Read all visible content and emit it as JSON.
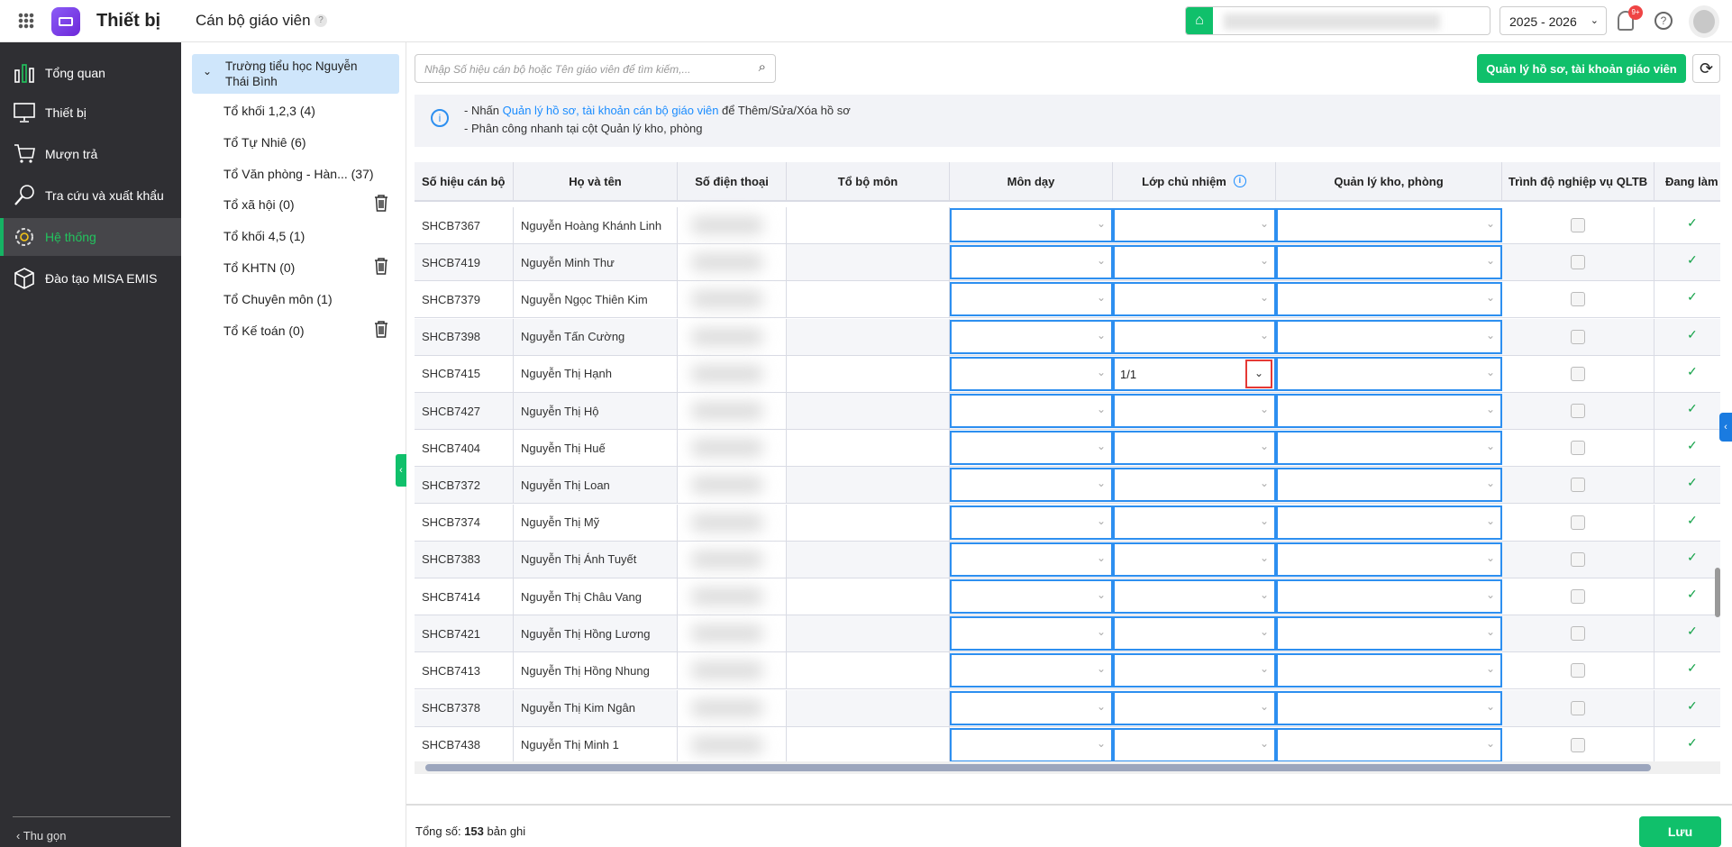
{
  "header": {
    "app_name": "Thiết bị",
    "page_title": "Cán bộ giáo viên",
    "help_badge": "?",
    "school_year": "2025 - 2026",
    "notification_count": "9+"
  },
  "sidebar": {
    "items": [
      {
        "label": "Tổng quan",
        "icon": "bar-chart-icon"
      },
      {
        "label": "Thiết bị",
        "icon": "monitor-icon"
      },
      {
        "label": "Mượn trả",
        "icon": "cart-icon"
      },
      {
        "label": "Tra cứu và xuất khẩu",
        "icon": "search-icon"
      },
      {
        "label": "Hệ thống",
        "icon": "gear-icon",
        "active": true
      },
      {
        "label": "Đào tạo MISA EMIS",
        "icon": "cube-icon"
      }
    ],
    "collapse_label": "Thu gọn"
  },
  "tree": {
    "root": "Trường tiểu học Nguyễn Thái Bình",
    "items": [
      {
        "label": "Tổ khối 1,2,3 (4)"
      },
      {
        "label": "Tổ Tự Nhiê (6)"
      },
      {
        "label": "Tổ Văn phòng - Hàn... (37)"
      },
      {
        "label": "Tổ xã hội (0)",
        "deletable": true
      },
      {
        "label": "Tổ khối 4,5 (1)"
      },
      {
        "label": "Tổ KHTN (0)",
        "deletable": true
      },
      {
        "label": "Tổ Chuyên môn (1)"
      },
      {
        "label": "Tổ Kế toán (0)",
        "deletable": true
      }
    ]
  },
  "toolbar": {
    "search_placeholder": "Nhập Số hiệu cán bộ hoặc Tên giáo viên để tìm kiếm,...",
    "manage_button": "Quản lý hồ sơ, tài khoản giáo viên"
  },
  "info": {
    "line1_prefix": "- Nhấn ",
    "line1_link": "Quản lý hồ sơ, tài khoản cán bộ giáo viên",
    "line1_suffix": " để Thêm/Sửa/Xóa hồ sơ",
    "line2": "- Phân công nhanh tại cột Quản lý kho, phòng"
  },
  "table": {
    "columns": [
      "Số hiệu cán bộ",
      "Họ và tên",
      "Số điện thoại",
      "Tổ bộ môn",
      "Môn dạy",
      "Lớp chủ nhiệm",
      "Quản lý kho, phòng",
      "Trình độ nghiệp vụ QLTB",
      "Đang làm"
    ],
    "rows": [
      {
        "id": "SHCB7367",
        "name": "Nguyễn Hoàng Khánh Linh",
        "class": ""
      },
      {
        "id": "SHCB7419",
        "name": "Nguyễn Minh Thư",
        "class": ""
      },
      {
        "id": "SHCB7379",
        "name": "Nguyễn Ngọc Thiên Kim",
        "class": ""
      },
      {
        "id": "SHCB7398",
        "name": "Nguyễn Tấn Cường",
        "class": ""
      },
      {
        "id": "SHCB7415",
        "name": "Nguyễn Thị Hạnh",
        "class": "1/1",
        "focused": true
      },
      {
        "id": "SHCB7427",
        "name": "Nguyễn Thị Hộ",
        "class": ""
      },
      {
        "id": "SHCB7404",
        "name": "Nguyễn Thị Huế",
        "class": ""
      },
      {
        "id": "SHCB7372",
        "name": "Nguyễn Thị Loan",
        "class": ""
      },
      {
        "id": "SHCB7374",
        "name": "Nguyễn Thị Mỹ",
        "class": ""
      },
      {
        "id": "SHCB7383",
        "name": "Nguyễn Thị Ánh Tuyết",
        "class": ""
      },
      {
        "id": "SHCB7414",
        "name": "Nguyễn Thị Châu Vang",
        "class": ""
      },
      {
        "id": "SHCB7421",
        "name": "Nguyễn Thị Hồng Lương",
        "class": ""
      },
      {
        "id": "SHCB7413",
        "name": "Nguyễn Thị Hồng Nhung",
        "class": ""
      },
      {
        "id": "SHCB7378",
        "name": "Nguyễn Thị Kim Ngân",
        "class": ""
      },
      {
        "id": "SHCB7438",
        "name": "Nguyễn Thị Minh 1",
        "class": ""
      }
    ]
  },
  "footer": {
    "total_prefix": "Tổng số: ",
    "total_count": "153",
    "total_suffix": " bản ghi",
    "save_button": "Lưu"
  },
  "colors": {
    "accent": "#10c06b",
    "link": "#1a8cff",
    "focus": "#2d8ff0",
    "highlight": "#e53935"
  }
}
